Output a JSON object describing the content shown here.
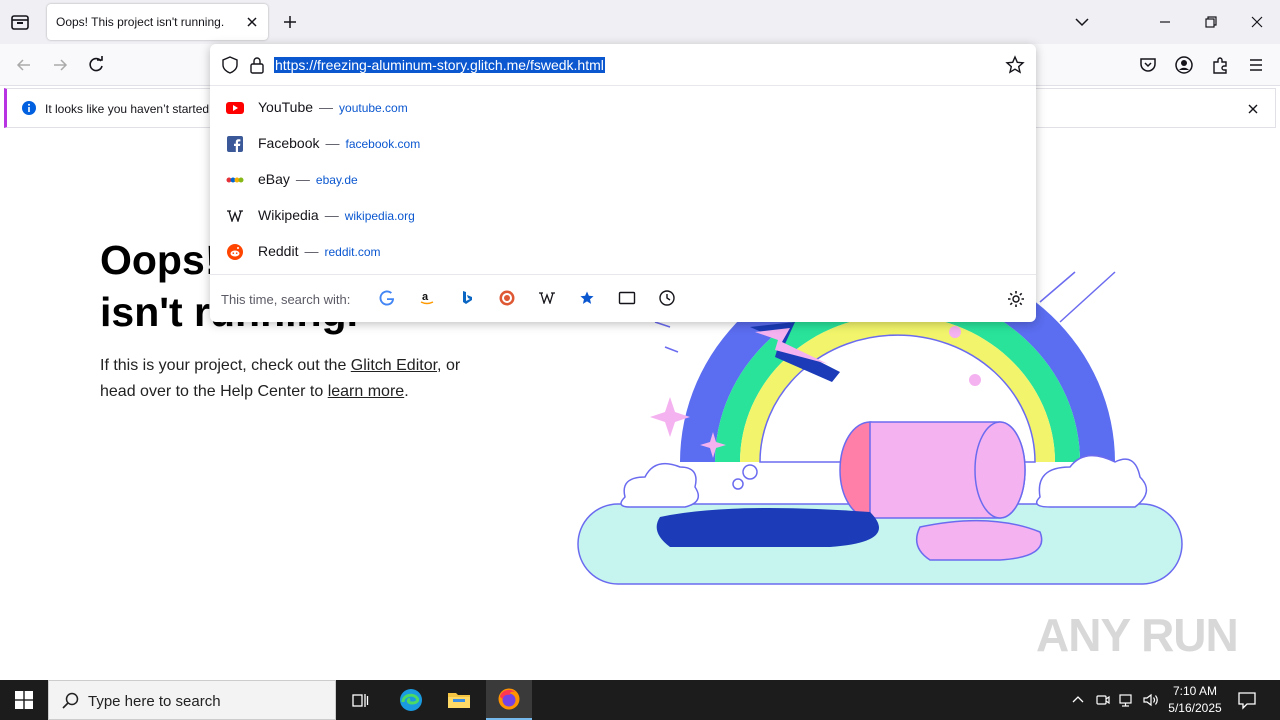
{
  "tab": {
    "title": "Oops! This project isn't running."
  },
  "url_bar": {
    "url": "https://freezing-aluminum-story.glitch.me/fswedk.html"
  },
  "notification": {
    "text": "It looks like you haven’t started"
  },
  "suggestions": [
    {
      "title": "YouTube",
      "url": "youtube.com",
      "icon": "youtube-icon"
    },
    {
      "title": "Facebook",
      "url": "facebook.com",
      "icon": "facebook-icon"
    },
    {
      "title": "eBay",
      "url": "ebay.de",
      "icon": "ebay-icon"
    },
    {
      "title": "Wikipedia",
      "url": "wikipedia.org",
      "icon": "wikipedia-icon"
    },
    {
      "title": "Reddit",
      "url": "reddit.com",
      "icon": "reddit-icon"
    }
  ],
  "suggestion_separator": "—",
  "search_engines": {
    "label": "This time, search with:",
    "items": [
      "google-icon",
      "amazon-icon",
      "bing-icon",
      "duckduckgo-icon",
      "wikipedia-icon",
      "bookmarks-icon",
      "tabs-icon",
      "history-icon"
    ]
  },
  "page": {
    "headline_line1": "Oops!",
    "headline_line2": "isn't running.",
    "body_prefix": "If this is your project, check out the ",
    "link_editor": "Glitch Editor",
    "body_middle": ", or head over to the Help Center to ",
    "link_learn": "learn more",
    "body_suffix": "."
  },
  "watermark": "ANY RUN",
  "taskbar": {
    "search_placeholder": "Type here to search",
    "time": "7:10 AM",
    "date": "5/16/2025"
  },
  "colors": {
    "accent": "#0b57d0",
    "notice_border": "#b833e1",
    "taskbar": "#1c1c1c"
  }
}
